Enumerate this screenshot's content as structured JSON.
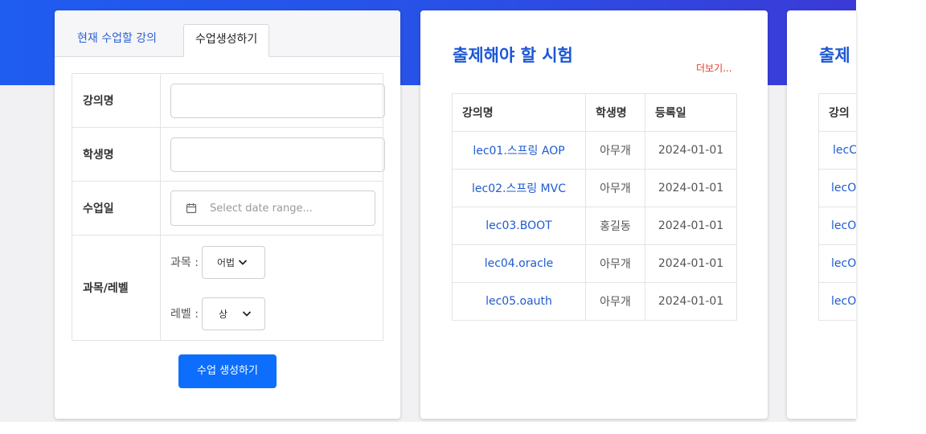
{
  "form_card": {
    "tabs": [
      {
        "label": "현재 수업할 강의",
        "active": false
      },
      {
        "label": "수업생성하기",
        "active": true
      }
    ],
    "fields": {
      "lecture_label": "강의명",
      "lecture_value": "",
      "student_label": "학생명",
      "student_value": "",
      "date_label": "수업일",
      "date_placeholder": "Select date range...",
      "subject_level_label": "과목/레벨",
      "subject_prefix": "과목 :",
      "subject_value": "어법",
      "level_prefix": "레벨 :",
      "level_value": "상"
    },
    "submit_label": "수업 생성하기"
  },
  "exams_card": {
    "title": "출제해야 할 시험",
    "more_label": "더보기...",
    "columns": [
      "강의명",
      "학생명",
      "등록일"
    ],
    "rows": [
      {
        "lecture": "lec01.스프링 AOP",
        "student": "아무개",
        "date": "2024-01-01"
      },
      {
        "lecture": "lec02.스프링 MVC",
        "student": "아무개",
        "date": "2024-01-01"
      },
      {
        "lecture": "lec03.BOOT",
        "student": "홍길동",
        "date": "2024-01-01"
      },
      {
        "lecture": "lec04.oracle",
        "student": "아무개",
        "date": "2024-01-01"
      },
      {
        "lecture": "lec05.oauth",
        "student": "아무개",
        "date": "2024-01-01"
      }
    ]
  },
  "right_card": {
    "title": "출제",
    "column": "강의",
    "rows": [
      "lecC",
      "lecO",
      "lecO",
      "lecO",
      "lecO"
    ]
  },
  "colors": {
    "hero_start": "#1f5cf0",
    "hero_end": "#3b3ad6",
    "primary": "#0d6efd",
    "link": "#1f5bd0",
    "title": "#1b57d6",
    "more": "#e53b2c"
  }
}
